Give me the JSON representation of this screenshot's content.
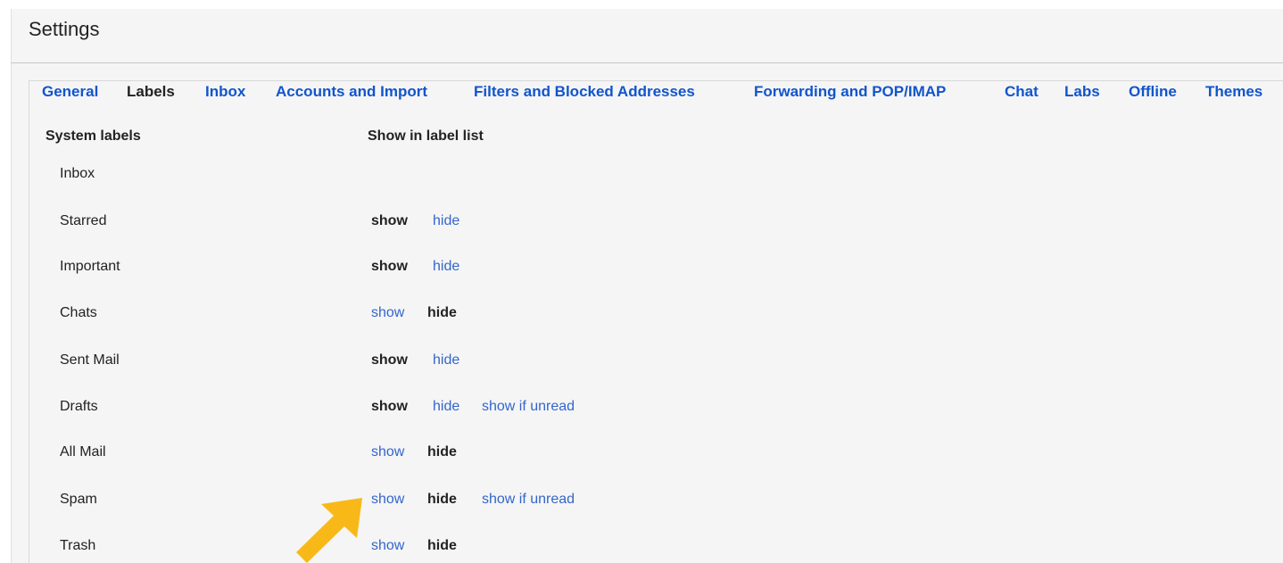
{
  "header": {
    "title": "Settings"
  },
  "tabs": [
    {
      "label": "General",
      "active": false
    },
    {
      "label": "Labels",
      "active": true
    },
    {
      "label": "Inbox",
      "active": false
    },
    {
      "label": "Accounts and Import",
      "active": false
    },
    {
      "label": "Filters and Blocked Addresses",
      "active": false
    },
    {
      "label": "Forwarding and POP/IMAP",
      "active": false
    },
    {
      "label": "Chat",
      "active": false
    },
    {
      "label": "Labs",
      "active": false
    },
    {
      "label": "Offline",
      "active": false
    },
    {
      "label": "Themes",
      "active": false
    }
  ],
  "columns": {
    "system_labels": "System labels",
    "show_in_label_list": "Show in label list"
  },
  "labels": [
    {
      "name": "Inbox"
    },
    {
      "name": "Starred",
      "show": "show",
      "hide": "hide",
      "selected": "show"
    },
    {
      "name": "Important",
      "show": "show",
      "hide": "hide",
      "selected": "show"
    },
    {
      "name": "Chats",
      "show": "show",
      "hide": "hide",
      "selected": "hide"
    },
    {
      "name": "Sent Mail",
      "show": "show",
      "hide": "hide",
      "selected": "show"
    },
    {
      "name": "Drafts",
      "show": "show",
      "hide": "hide",
      "unread": "show if unread",
      "selected": "show"
    },
    {
      "name": "All Mail",
      "show": "show",
      "hide": "hide",
      "selected": "hide"
    },
    {
      "name": "Spam",
      "show": "show",
      "hide": "hide",
      "unread": "show if unread",
      "selected": "hide"
    },
    {
      "name": "Trash",
      "show": "show",
      "hide": "hide",
      "selected": "hide"
    }
  ],
  "colors": {
    "link": "#3366cc",
    "tab_link": "#1155cc",
    "text": "#222222",
    "background": "#f5f5f5",
    "arrow": "#f8b918"
  },
  "annotation": {
    "icon": "arrow-pointer-icon"
  }
}
